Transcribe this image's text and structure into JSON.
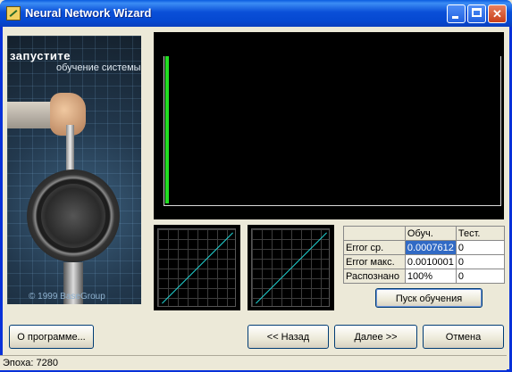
{
  "window": {
    "title": "Neural Network Wizard",
    "controls": {
      "minimize": "minimize-icon",
      "maximize": "maximize-icon",
      "close": "close-icon"
    }
  },
  "banner": {
    "title": "запустите",
    "subtitle": "обучение системы",
    "copyright": "© 1999 BaseGroup"
  },
  "progress_plot": {
    "error_fraction": 0.98,
    "bar_color": "#22dd22"
  },
  "stats": {
    "headers": [
      "",
      "Обуч.",
      "Тест."
    ],
    "rows": [
      {
        "label": "Error ср.",
        "train": "0.0007612",
        "test": "0"
      },
      {
        "label": "Error макс.",
        "train": "0.0010001",
        "test": "0"
      },
      {
        "label": "Распознано",
        "train": "100%",
        "test": "0"
      }
    ]
  },
  "buttons": {
    "train": "Пуск обучения",
    "about": "О программе...",
    "back": "<< Назад",
    "next": "Далее >>",
    "cancel": "Отмена"
  },
  "status": {
    "text": "Эпоха: 7280"
  },
  "colors": {
    "titlebar": "#0a4fd8",
    "selection": "#316ac5",
    "diagonal": "#20d0d0"
  }
}
